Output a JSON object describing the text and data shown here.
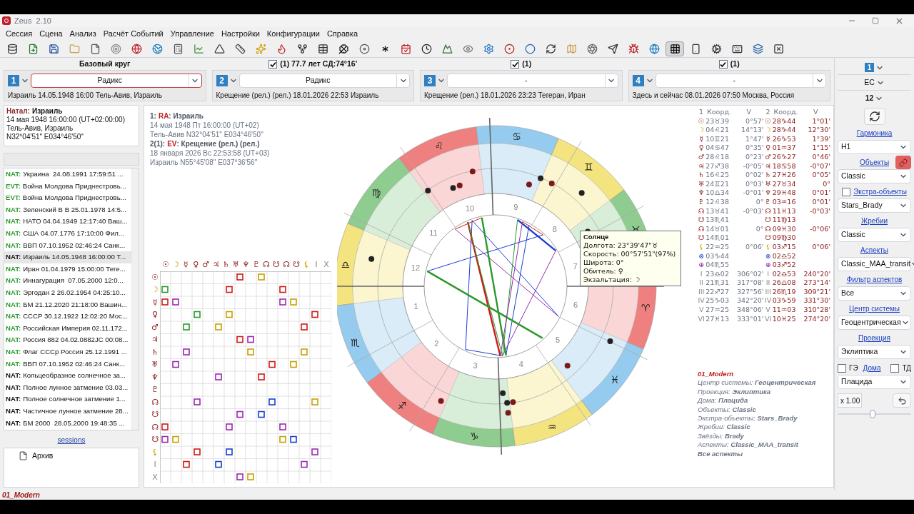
{
  "window": {
    "title": "Zeus  2.10"
  },
  "menu": [
    "Сессия",
    "Сцена",
    "Анализ",
    "Расчёт Событий",
    "Управление",
    "Настройки",
    "Конфигурации",
    "Справка"
  ],
  "toolbar": [
    {
      "selected": false
    },
    {
      "selected": false
    },
    {
      "selected": false
    },
    {
      "selected": false
    },
    {
      "selected": false
    },
    {
      "selected": false
    },
    {
      "selected": false
    },
    {
      "selected": false
    },
    {
      "selected": false
    },
    {
      "selected": false
    },
    {
      "selected": false
    },
    {
      "selected": false
    },
    {
      "selected": false
    },
    {
      "selected": false
    },
    {
      "selected": false
    },
    {
      "selected": false
    },
    {
      "selected": false
    },
    {
      "selected": false
    },
    {
      "selected": false
    },
    {
      "selected": false
    },
    {
      "selected": false
    },
    {
      "selected": false
    },
    {
      "selected": false
    },
    {
      "selected": false
    },
    {
      "selected": false
    },
    {
      "selected": false
    },
    {
      "selected": false
    },
    {
      "selected": false
    },
    {
      "selected": false
    },
    {
      "selected": false
    },
    {
      "selected": false
    },
    {
      "selected": false
    },
    {
      "selected": true
    },
    {
      "selected": false
    },
    {
      "selected": false
    },
    {
      "selected": false
    },
    {
      "selected": false
    },
    {
      "selected": false
    }
  ],
  "panels": [
    {
      "header": {
        "kind": "title",
        "label": "Базовый круг"
      },
      "number": "1",
      "value": "Радикс",
      "active": true,
      "caption": "Израиль 14.05.1948 16:00 Тель-Авив, Израиль"
    },
    {
      "header": {
        "kind": "toggle",
        "label": "(1) 77.7 лет СД:74°16'",
        "checked": true
      },
      "number": "2",
      "value": "Радикс",
      "active": false,
      "caption": "Крещение (рел.) (рел.) 18.01.2026 22:53 Израиль"
    },
    {
      "header": {
        "kind": "toggle",
        "label": "(1)",
        "checked": true
      },
      "number": "3",
      "value": "-",
      "active": false,
      "caption": "Крещение (рел.) 18.01.2026 23:23 Тегеран, Иран"
    },
    {
      "header": {
        "kind": "toggle",
        "label": "(1)",
        "checked": true
      },
      "number": "4",
      "value": "-",
      "active": false,
      "caption": "Здесь и сейчас 08.01.2026 07:50 Москва, Россия"
    }
  ],
  "natal": {
    "label": "Натал:",
    "name": "Израиль",
    "lines": [
      "14 мая 1948 16:00:00 (UT+02:00:00)",
      "Тель-Авив, Израиль",
      "N32°04'51\" E034°46'50\""
    ]
  },
  "charts_list": [
    {
      "tag": "NAT:",
      "text": "Украина  24.08.1991 17:59:51 ...",
      "color": "#2e9a2e",
      "selected": false
    },
    {
      "tag": "EVT:",
      "text": "Война Молдова Приднестровь...",
      "color": "#2e9a2e",
      "selected": false
    },
    {
      "tag": "EVT:",
      "text": "Война Молдова Приднестровь...",
      "color": "#2e9a2e",
      "selected": false
    },
    {
      "tag": "NAT:",
      "text": "Зеленский В В 25.01.1978 14:5...",
      "color": "#2e9a2e",
      "selected": false
    },
    {
      "tag": "NAT:",
      "text": "НАТО 04.04.1949 12:17:40 Ваш...",
      "color": "#2e9a2e",
      "selected": false
    },
    {
      "tag": "NAT:",
      "text": "США 04.07.1776 17:10:00 Фил...",
      "color": "#2e9a2e",
      "selected": false
    },
    {
      "tag": "NAT:",
      "text": "ВВП 07.10.1952 02:46:24 Санк...",
      "color": "#2e9a2e",
      "selected": false
    },
    {
      "tag": "NAT:",
      "text": "Израиль 14.05.1948 16:00:00 Т...",
      "color": "#111111",
      "selected": true
    },
    {
      "tag": "NAT:",
      "text": "Иран 01.04.1979 15:00:00 Теге...",
      "color": "#2e9a2e",
      "selected": false
    },
    {
      "tag": "NAT:",
      "text": "Иннагурация  07.05.2000 12:0...",
      "color": "#2e9a2e",
      "selected": false
    },
    {
      "tag": "NAT:",
      "text": "Эргодан 2 26.02.1954 04:25:10...",
      "color": "#2e9a2e",
      "selected": false
    },
    {
      "tag": "NAT:",
      "text": "БМ 21.12.2020 21:18:00 Вашин...",
      "color": "#2e9a2e",
      "selected": false
    },
    {
      "tag": "NAT:",
      "text": "СССР 30.12.1922 12:02:20 Мос...",
      "color": "#2e9a2e",
      "selected": false
    },
    {
      "tag": "NAT:",
      "text": "Российская Империя 02.11.172...",
      "color": "#2e9a2e",
      "selected": false
    },
    {
      "tag": "NAT:",
      "text": "Россия 882 04.02.0882JC 00:08...",
      "color": "#2e9a2e",
      "selected": false
    },
    {
      "tag": "NAT:",
      "text": "Флаг СССр Россия 25.12.1991 ...",
      "color": "#2e9a2e",
      "selected": false
    },
    {
      "tag": "NAT:",
      "text": "ВВП 07.10.1952 02:46:24 Санк...",
      "color": "#2e9a2e",
      "selected": false
    },
    {
      "tag": "NAT:",
      "text": "Кольцеобразное солнечное за...",
      "color": "#111111",
      "selected": false
    },
    {
      "tag": "NAT:",
      "text": "Полное лунное затмение 03.03...",
      "color": "#111111",
      "selected": false
    },
    {
      "tag": "NAT:",
      "text": "Полное солнечное затмение 1...",
      "color": "#111111",
      "selected": false
    },
    {
      "tag": "NAT:",
      "text": "Частичное лунное затмение 28...",
      "color": "#111111",
      "selected": false
    },
    {
      "tag": "NAT:",
      "text": "БМ 2000  28.05.2000 19:48:35 ...",
      "color": "#111111",
      "selected": false
    }
  ],
  "sessions_link": "sessions",
  "sessions_tree": [
    {
      "label": "Архив"
    }
  ],
  "status_bar": "01_Modern",
  "chart_info": [
    {
      "index": "1:",
      "code": "RA",
      "title": ": Израиль",
      "lines": [
        "14 мая 1948 Пт 16:00:00 (UT+02)",
        "Тель-Авив N32°04'51\" E034°46'50\""
      ]
    },
    {
      "index": "2(1):",
      "code": "EV",
      "title": ": Крещение (рел.) (рел.)",
      "lines": [
        "18 января 2026 Вс 22:53:58 (UT+03)",
        "Израиль N55°45'08\" E037°36'56\""
      ]
    }
  ],
  "aspect_grid": {
    "columns": [
      {
        "glyph": "☉",
        "kind": "planet"
      },
      {
        "glyph": "☽",
        "kind": "moon"
      },
      {
        "glyph": "☿",
        "kind": "planet"
      },
      {
        "glyph": "♀",
        "kind": "planet"
      },
      {
        "glyph": "♂",
        "kind": "planet"
      },
      {
        "glyph": "♃",
        "kind": "planet"
      },
      {
        "glyph": "♄",
        "kind": "planet"
      },
      {
        "glyph": "♅",
        "kind": "planet"
      },
      {
        "glyph": "♆",
        "kind": "planet"
      },
      {
        "glyph": "♇",
        "kind": "planet"
      },
      {
        "glyph": "☊",
        "kind": "planet"
      },
      {
        "glyph": "☋",
        "kind": "planet"
      },
      {
        "glyph": "☊",
        "kind": "planet"
      },
      {
        "glyph": "☋",
        "kind": "planet"
      },
      {
        "glyph": "⚸",
        "kind": "lilith"
      },
      {
        "glyph": "I",
        "kind": "house"
      },
      {
        "glyph": "X",
        "kind": "house"
      }
    ],
    "rows": [
      {
        "glyph": "☉",
        "kind": "planet"
      },
      {
        "glyph": "☽",
        "kind": "moon"
      },
      {
        "glyph": "☿",
        "kind": "planet"
      },
      {
        "glyph": "♀",
        "kind": "planet"
      },
      {
        "glyph": "♂",
        "kind": "planet"
      },
      {
        "glyph": "♃",
        "kind": "planet"
      },
      {
        "glyph": "♄",
        "kind": "planet"
      },
      {
        "glyph": "♅",
        "kind": "planet"
      },
      {
        "glyph": "♆",
        "kind": "planet"
      },
      {
        "glyph": "♇",
        "kind": "planet"
      },
      {
        "glyph": "☊",
        "kind": "planet"
      },
      {
        "glyph": "☋",
        "kind": "planet"
      },
      {
        "glyph": "☊",
        "kind": "planet"
      },
      {
        "glyph": "☋",
        "kind": "planet"
      },
      {
        "glyph": "⚸",
        "kind": "lilith"
      },
      {
        "glyph": "I",
        "kind": "house"
      },
      {
        "glyph": "X",
        "kind": "house"
      }
    ]
  },
  "wheel": {
    "signs": [
      "♈",
      "♉",
      "♊",
      "♋",
      "♌",
      "♍",
      "♎",
      "♏",
      "♐",
      "♑",
      "♒",
      "♓"
    ],
    "house_numbers": [
      "1",
      "2",
      "3",
      "4",
      "5",
      "6",
      "7",
      "8",
      "9",
      "10",
      "11",
      "12"
    ]
  },
  "tooltip": {
    "title": "Солнце",
    "lines": [
      "Долгота: 23°39'47\"♉",
      "Скорость: 00°57'51\"(97%)",
      "Широта: 0°",
      "Обитель: ♀",
      "Экзальтация: ☽"
    ]
  },
  "positions": {
    "columns": [
      "1",
      "Коорд.",
      "V",
      "2",
      "Коорд.",
      "V"
    ],
    "rows": [
      {
        "kind": "planet",
        "glyph1": "☉",
        "coord1": "23♉39",
        "v1": "0°57'",
        "glyph2": "☉",
        "coord2": "28♑44",
        "v2": "1°01'"
      },
      {
        "kind": "moon",
        "glyph1": "☽",
        "coord1": "04♌21",
        "v1": "14°13'",
        "glyph2": "☽",
        "coord2": "28♑44",
        "v2": "12°30'"
      },
      {
        "kind": "planet",
        "glyph1": "☿",
        "coord1": "10♊21",
        "v1": "1°47'",
        "glyph2": "☿",
        "coord2": "26♑53",
        "v2": "1°39'"
      },
      {
        "kind": "planet",
        "glyph1": "♀",
        "coord1": "04♋47",
        "v1": "0°35'",
        "glyph2": "♀",
        "coord2": "01♒37",
        "v2": "1°15'"
      },
      {
        "kind": "planet",
        "glyph1": "♂",
        "coord1": "28♌18",
        "v1": "0°23'",
        "glyph2": "♂",
        "coord2": "26♑27",
        "v2": "0°46'"
      },
      {
        "kind": "planet",
        "glyph1": "♃",
        "coord1": "27♐38",
        "v1": "-0°05'",
        "glyph2": "♃",
        "coord2": "18♋58",
        "v2": "-0°07'"
      },
      {
        "kind": "planet",
        "glyph1": "♄",
        "coord1": "16♌25",
        "v1": "0°02'",
        "glyph2": "♄",
        "coord2": "27♓26",
        "v2": "0°05'"
      },
      {
        "kind": "planet",
        "glyph1": "♅",
        "coord1": "24♊21",
        "v1": "0°03'",
        "glyph2": "♅",
        "coord2": "27♉34",
        "v2": "0°"
      },
      {
        "kind": "planet",
        "glyph1": "♆",
        "coord1": "10♎34",
        "v1": "-0°01'",
        "glyph2": "♆",
        "coord2": "29♓48",
        "v2": "0°01'"
      },
      {
        "kind": "planet",
        "glyph1": "♇",
        "coord1": "12♌38",
        "v1": "0°",
        "glyph2": "♇",
        "coord2": "03♒16",
        "v2": "0°01'"
      },
      {
        "kind": "planet",
        "glyph1": "☊",
        "coord1": "13♉41",
        "v1": "-0°03'",
        "glyph2": "☊",
        "coord2": "11♓13",
        "v2": "-0°03'"
      },
      {
        "kind": "planet",
        "glyph1": "☋",
        "coord1": "13♏41",
        "glyph2": "☋",
        "coord2": "11♍13"
      },
      {
        "kind": "planet",
        "glyph1": "☊",
        "coord1": "14♉01",
        "v1": "0°",
        "glyph2": "☊",
        "coord2": "09♓30",
        "v2": "-0°06'"
      },
      {
        "kind": "planet",
        "glyph1": "☋",
        "coord1": "14♏01",
        "glyph2": "☋",
        "coord2": "09♍30"
      },
      {
        "kind": "lilith",
        "glyph1": "⚸",
        "coord1": "22♒25",
        "v1": "0°06'",
        "glyph2": "⚸",
        "coord2": "03♐15",
        "v2": "0°06'"
      },
      {
        "kind": "fortune",
        "glyph1": "⊗",
        "coord1": "03♑44",
        "glyph2": "⊗",
        "coord2": "02♎52"
      },
      {
        "kind": "spirit",
        "glyph1": "⊕",
        "coord1": "04♏55",
        "glyph2": "⊕",
        "coord2": "03♐52"
      },
      {
        "kind": "house",
        "glyph1": "I",
        "coord1": "23♎02",
        "v1": "306°02'",
        "glyph2": "I",
        "coord2": "02♎53",
        "v2": "240°20'"
      },
      {
        "kind": "house",
        "glyph1": "II",
        "coord1": "21♏31",
        "v1": "317°08'",
        "glyph2": "II",
        "coord2": "26♎08",
        "v2": "273°14'"
      },
      {
        "kind": "house",
        "glyph1": "III",
        "coord1": "22♐27",
        "v1": "327°56'",
        "glyph2": "III",
        "coord2": "26♏19",
        "v2": "309°21'"
      },
      {
        "kind": "house",
        "glyph1": "IV",
        "coord1": "25♑03",
        "v1": "342°20'",
        "glyph2": "IV",
        "coord2": "03♑59",
        "v2": "331°30'"
      },
      {
        "kind": "house",
        "glyph1": "V",
        "coord1": "27♒25",
        "v1": "348°06'",
        "glyph2": "V",
        "coord2": "11♒03",
        "v2": "310°28'"
      },
      {
        "kind": "house",
        "glyph1": "VI",
        "coord1": "27♓13",
        "v1": "333°01'",
        "glyph2": "VI",
        "coord2": "10♓25",
        "v2": "274°20'"
      }
    ]
  },
  "settings_summary": {
    "title": "01_Modern",
    "lines": [
      "Центр системы: **Геоцентрическая**",
      "Проекция: **Эклиптика**",
      "Дома: **Плацида**",
      "Объекты: **Classic**",
      "Экстра-объекты: **Stars_Brady**",
      "Жребии: **Classic**",
      "Звёзды: **Brady**",
      "Аспекты: **Classic_MAA_transit**",
      "**Все аспекты**"
    ]
  },
  "sidebar": {
    "chart_number": "1",
    "zodiac": "EC",
    "houses_count": "12",
    "sections": [
      {
        "kind": "plain",
        "label": "Гармоника",
        "value": "H1"
      },
      {
        "kind": "linked",
        "label": "Объекты",
        "value": "Classic",
        "on": true
      },
      {
        "kind": "checkbox",
        "label": "Экстра-объекты",
        "value": "Stars_Brady",
        "checked": false
      },
      {
        "kind": "plain",
        "label": "Жребии",
        "value": "Classic"
      },
      {
        "kind": "plain",
        "label": "Аспекты",
        "value": "Classic_MAA_transit"
      },
      {
        "kind": "plain",
        "label": "Фильтр аспектов",
        "value": "Все"
      },
      {
        "kind": "plain",
        "label": "Центр системы",
        "value": "Геоцентрическая"
      },
      {
        "kind": "plain",
        "label": "Проекция",
        "value": "Эклиптика"
      }
    ],
    "houses": {
      "ge_label": "ГЭ",
      "ge_checked": false,
      "label": "Дома",
      "td_label": "ТД",
      "td_checked": false,
      "value": "Плацида"
    },
    "zoom": {
      "value": "x 1.00",
      "level": 0.48
    }
  }
}
